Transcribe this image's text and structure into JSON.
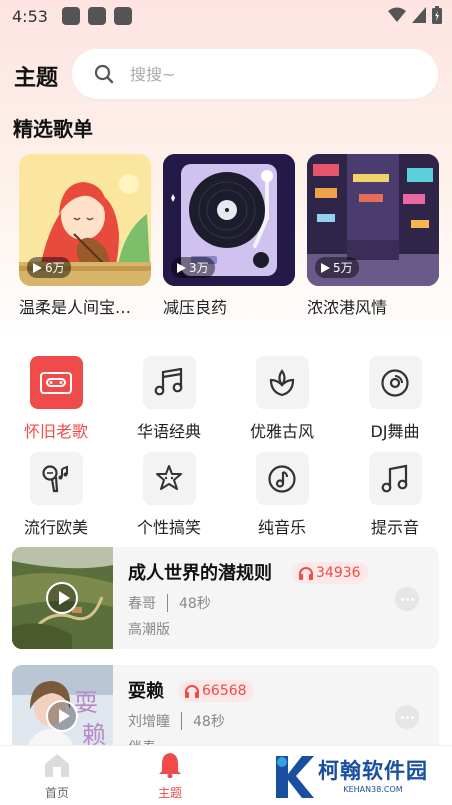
{
  "status_bar": {
    "time": "4:53"
  },
  "header": {
    "title": "主题",
    "search_placeholder": "搜搜~"
  },
  "section": {
    "title": "精选歌单"
  },
  "playlists": [
    {
      "name": "温柔是人间宝…",
      "count": "6万"
    },
    {
      "name": "减压良药",
      "count": "3万"
    },
    {
      "name": "浓浓港风情",
      "count": "5万"
    }
  ],
  "categories": [
    {
      "label": "怀旧老歌",
      "icon": "cassette-icon",
      "active": true
    },
    {
      "label": "华语经典",
      "icon": "music-notes-icon"
    },
    {
      "label": "优雅古风",
      "icon": "lotus-icon"
    },
    {
      "label": "DJ舞曲",
      "icon": "vinyl-icon"
    },
    {
      "label": "流行欧美",
      "icon": "microphone-icon"
    },
    {
      "label": "个性搞笑",
      "icon": "funny-face-icon"
    },
    {
      "label": "纯音乐",
      "icon": "music-disc-icon"
    },
    {
      "label": "提示音",
      "icon": "music-note-icon"
    }
  ],
  "songs": [
    {
      "title": "成人世界的潜规则",
      "heat": "34936",
      "artist": "春哥",
      "duration": "48秒",
      "tag": "高潮版"
    },
    {
      "title": "耍赖",
      "heat": "66568",
      "artist": "刘增瞳",
      "duration": "48秒",
      "tag": "伴奏"
    }
  ],
  "nav": {
    "home": "首页",
    "theme": "主题"
  },
  "watermark": {
    "text": "柯翰软件园",
    "sub": "KEHAN38.COM"
  },
  "colors": {
    "accent": "#ef4b4b",
    "heat_bg": "#fde8e8"
  }
}
